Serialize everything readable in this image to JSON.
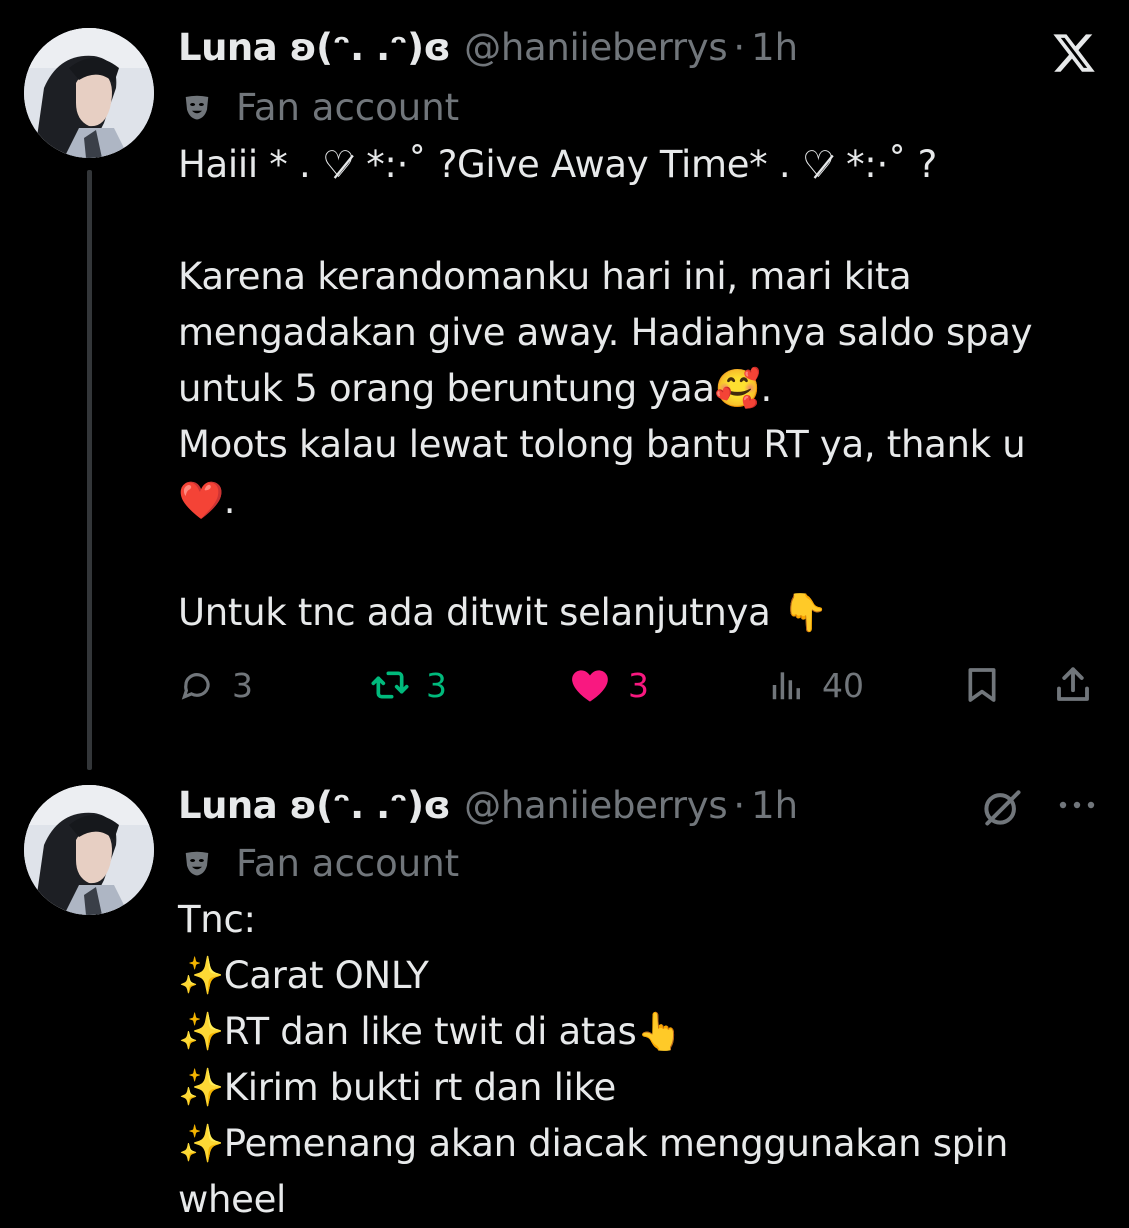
{
  "colors": {
    "background": "#000000",
    "text": "#e7e9ea",
    "muted": "#71767b",
    "retweet_active": "#00ba7c",
    "like_active": "#f91880"
  },
  "header": {
    "x_logo_icon": "x-logo-icon"
  },
  "tweets": [
    {
      "display_name": "Luna ʚ(ᵔ. .ᵔ)ɞ",
      "handle": "@haniieberrys",
      "separator": "·",
      "time": "1h",
      "label": "Fan account",
      "label_icon": "theater-mask-icon",
      "body": "Haiii * . ♡̷ *:·˚ ?Give Away Time* . ♡̷ *:·˚ ?\n\nKarena kerandomanku hari ini, mari kita\nmengadakan give away. Hadiahnya saldo spay\nuntuk 5 orang beruntung yaa🥰.\nMoots kalau lewat tolong bantu RT ya, thank u\n❤️.\n\nUntuk tnc ada ditwit selanjutnya 👇",
      "actions": {
        "reply_count": "3",
        "retweet_count": "3",
        "like_count": "3",
        "views_count": "40",
        "reply_icon": "reply-icon",
        "retweet_icon": "retweet-icon",
        "like_icon": "heart-filled-icon",
        "views_icon": "views-icon",
        "bookmark_icon": "bookmark-icon",
        "share_icon": "share-icon"
      }
    },
    {
      "display_name": "Luna ʚ(ᵔ. .ᵔ)ɞ",
      "handle": "@haniieberrys",
      "separator": "·",
      "time": "1h",
      "label": "Fan account",
      "label_icon": "theater-mask-icon",
      "grok_icon": "grok-icon",
      "more_icon": "more-icon",
      "body": "Tnc:\n✨Carat ONLY\n✨RT dan like twit di atas👆\n✨Kirim bukti rt dan like\n✨Pemenang akan diacak menggunakan spin\nwheel"
    }
  ]
}
